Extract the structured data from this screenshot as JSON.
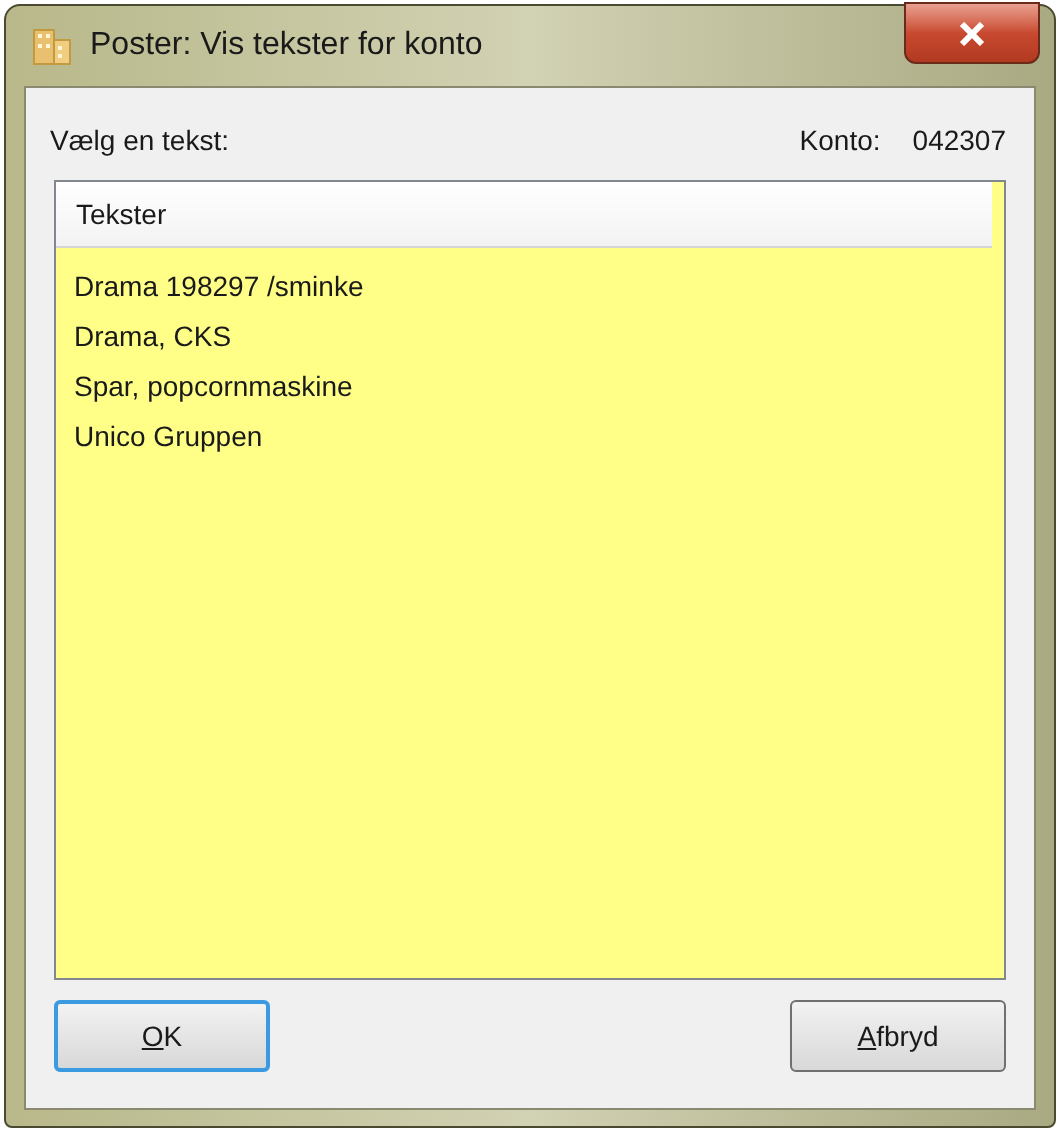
{
  "window": {
    "title": "Poster: Vis tekster for konto"
  },
  "prompt": "Vælg en tekst:",
  "account": {
    "label": "Konto:",
    "value": "042307"
  },
  "list": {
    "header": "Tekster",
    "rows": [
      {
        "text": "Drama 198297 /sminke"
      },
      {
        "text": "Drama, CKS"
      },
      {
        "text": "Spar, popcornmaskine"
      },
      {
        "text": "Unico Gruppen"
      }
    ]
  },
  "buttons": [
    {
      "label": "OK",
      "default": true
    },
    {
      "label": "Afbryd",
      "default": false
    }
  ]
}
